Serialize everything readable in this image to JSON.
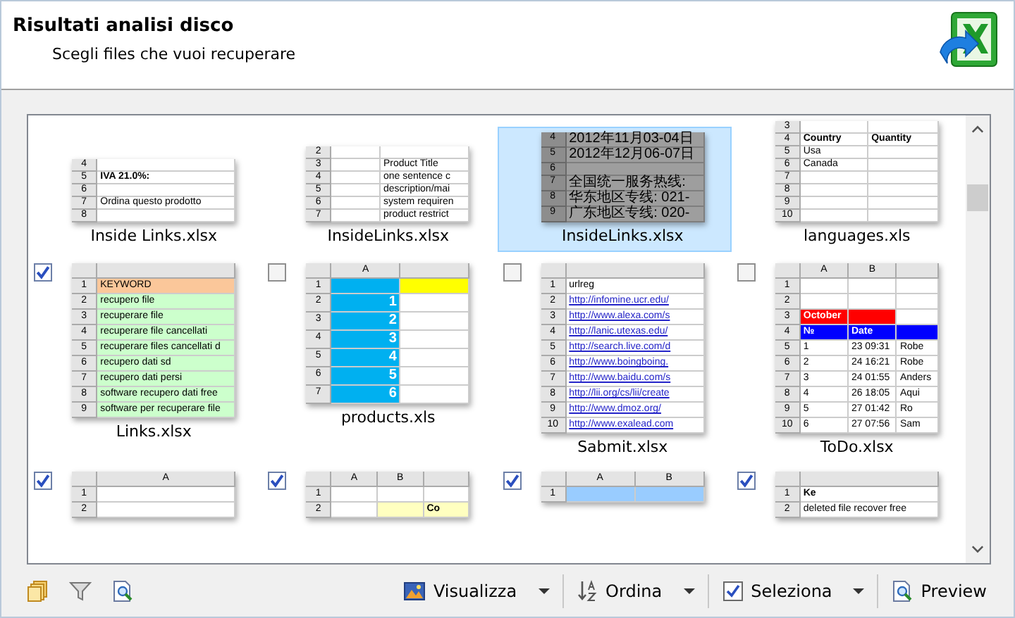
{
  "header": {
    "title": "Risultati analisi disco",
    "subtitle": "Scegli files che vuoi recuperare"
  },
  "grid_rows": [
    {
      "items": [
        {
          "name": "Inside Links.xlsx",
          "selected": false,
          "thumb": {
            "rows": [
              {
                "n": "4",
                "cells": [
                  {}
                ]
              },
              {
                "n": "5",
                "cells": [
                  {
                    "t": "IVA 21.0%:",
                    "kind": "bold"
                  }
                ]
              },
              {
                "n": "6",
                "cells": [
                  {}
                ]
              },
              {
                "n": "7",
                "cells": [
                  {
                    "t": "Ordina questo prodotto"
                  }
                ]
              },
              {
                "n": "8",
                "cells": [
                  {}
                ]
              }
            ]
          }
        },
        {
          "name": "InsideLinks.xlsx",
          "selected": false,
          "thumb": {
            "rows": [
              {
                "n": "2",
                "cells": [
                  {},
                  {}
                ]
              },
              {
                "n": "3",
                "cells": [
                  {},
                  {
                    "t": "Product Title"
                  }
                ]
              },
              {
                "n": "4",
                "cells": [
                  {},
                  {
                    "t": "one sentence c"
                  }
                ]
              },
              {
                "n": "5",
                "cells": [
                  {},
                  {
                    "t": "description/mai"
                  }
                ]
              },
              {
                "n": "6",
                "cells": [
                  {},
                  {
                    "t": "system requiren"
                  }
                ]
              },
              {
                "n": "7",
                "cells": [
                  {},
                  {
                    "t": "product restrict"
                  }
                ]
              }
            ]
          }
        },
        {
          "name": "InsideLinks.xlsx",
          "selected": true,
          "thumb": {
            "rows": [
              {
                "n": "4",
                "cells": [
                  {
                    "t": "2012年11月03-04日"
                  }
                ]
              },
              {
                "n": "5",
                "cells": [
                  {
                    "t": "2012年12月06-07日"
                  }
                ]
              },
              {
                "n": "6",
                "cells": [
                  {}
                ]
              },
              {
                "n": "7",
                "cells": [
                  {
                    "t": "全国统一服务热线:"
                  }
                ]
              },
              {
                "n": "8",
                "cells": [
                  {
                    "t": "华东地区专线: 021-"
                  }
                ]
              },
              {
                "n": "9",
                "cells": [
                  {
                    "t": "广东地区专线: 020-"
                  }
                ]
              }
            ]
          }
        },
        {
          "name": "languages.xls",
          "selected": false,
          "thumb": {
            "rows": [
              {
                "n": "3",
                "cells": [
                  {},
                  {}
                ]
              },
              {
                "n": "4",
                "cells": [
                  {
                    "t": "Country",
                    "kind": "bold"
                  },
                  {
                    "t": "Quantity",
                    "kind": "bold"
                  }
                ]
              },
              {
                "n": "5",
                "cells": [
                  {
                    "t": "Usa"
                  },
                  {}
                ]
              },
              {
                "n": "6",
                "cells": [
                  {
                    "t": "Canada"
                  },
                  {}
                ]
              },
              {
                "n": "7",
                "cells": [
                  {},
                  {}
                ]
              },
              {
                "n": "8",
                "cells": [
                  {},
                  {}
                ]
              },
              {
                "n": "9",
                "cells": [
                  {},
                  {}
                ]
              },
              {
                "n": "10",
                "cells": [
                  {},
                  {}
                ]
              }
            ]
          }
        }
      ]
    },
    {
      "items": [
        {
          "name": "Links.xlsx",
          "selected": false,
          "checked": true,
          "thumb": {
            "header": true,
            "rows": [
              {
                "n": "1",
                "cells": [
                  {
                    "t": "KEYWORD",
                    "color": "#fbc79a"
                  }
                ]
              },
              {
                "n": "2",
                "cells": [
                  {
                    "t": "recupero file",
                    "color": "#ccffcc"
                  }
                ]
              },
              {
                "n": "3",
                "cells": [
                  {
                    "t": "recuperare file",
                    "color": "#ccffcc"
                  }
                ]
              },
              {
                "n": "4",
                "cells": [
                  {
                    "t": "recuperare file cancellati",
                    "color": "#ccffcc"
                  }
                ]
              },
              {
                "n": "5",
                "cells": [
                  {
                    "t": "recuperare files cancellati d",
                    "color": "#ccffcc"
                  }
                ]
              },
              {
                "n": "6",
                "cells": [
                  {
                    "t": "recupero dati sd",
                    "color": "#ccffcc"
                  }
                ]
              },
              {
                "n": "7",
                "cells": [
                  {
                    "t": "recupero dati persi",
                    "color": "#ccffcc"
                  }
                ]
              },
              {
                "n": "8",
                "cells": [
                  {
                    "t": "software recupero dati free",
                    "color": "#ccffcc"
                  }
                ]
              },
              {
                "n": "9",
                "cells": [
                  {
                    "t": "software per recuperare file",
                    "color": "#ccffcc"
                  }
                ]
              }
            ]
          }
        },
        {
          "name": "products.xls",
          "selected": false,
          "checked": false,
          "thumb": {
            "header": true,
            "cols": [
              "A"
            ],
            "rows": [
              {
                "n": "1",
                "cells": [
                  {
                    "color": "#00b0f0"
                  },
                  {
                    "color": "#ffff00"
                  }
                ]
              },
              {
                "n": "2",
                "cells": [
                  {
                    "t": "1",
                    "color": "#00b0f0",
                    "kind": "number"
                  },
                  {}
                ]
              },
              {
                "n": "3",
                "cells": [
                  {
                    "t": "2",
                    "color": "#00b0f0",
                    "kind": "number"
                  },
                  {}
                ]
              },
              {
                "n": "4",
                "cells": [
                  {
                    "t": "3",
                    "color": "#00b0f0",
                    "kind": "number"
                  },
                  {}
                ]
              },
              {
                "n": "5",
                "cells": [
                  {
                    "t": "4",
                    "color": "#00b0f0",
                    "kind": "number"
                  },
                  {}
                ]
              },
              {
                "n": "6",
                "cells": [
                  {
                    "t": "5",
                    "color": "#00b0f0",
                    "kind": "number"
                  },
                  {}
                ]
              },
              {
                "n": "7",
                "cells": [
                  {
                    "t": "6",
                    "color": "#00b0f0",
                    "kind": "number"
                  },
                  {}
                ]
              }
            ]
          }
        },
        {
          "name": "Sabmit.xlsx",
          "selected": false,
          "checked": false,
          "thumb": {
            "header": true,
            "rows": [
              {
                "n": "1",
                "cells": [
                  {
                    "t": "urlreg"
                  }
                ]
              },
              {
                "n": "2",
                "cells": [
                  {
                    "t": "http://infomine.ucr.edu/",
                    "kind": "link"
                  }
                ]
              },
              {
                "n": "3",
                "cells": [
                  {
                    "t": "http://www.alexa.com/s",
                    "kind": "link"
                  }
                ]
              },
              {
                "n": "4",
                "cells": [
                  {
                    "t": "http://lanic.utexas.edu/",
                    "kind": "link"
                  }
                ]
              },
              {
                "n": "5",
                "cells": [
                  {
                    "t": "http://search.live.com/d",
                    "kind": "link"
                  }
                ]
              },
              {
                "n": "6",
                "cells": [
                  {
                    "t": "http://www.boingboing.",
                    "kind": "link"
                  }
                ]
              },
              {
                "n": "7",
                "cells": [
                  {
                    "t": "http://www.baidu.com/s",
                    "kind": "link"
                  }
                ]
              },
              {
                "n": "8",
                "cells": [
                  {
                    "t": "http://lii.org/cs/lii/create",
                    "kind": "link"
                  }
                ]
              },
              {
                "n": "9",
                "cells": [
                  {
                    "t": "http://www.dmoz.org/",
                    "kind": "link"
                  }
                ]
              },
              {
                "n": "10",
                "cells": [
                  {
                    "t": "http://www.exalead.com",
                    "kind": "link"
                  }
                ]
              }
            ]
          }
        },
        {
          "name": "ToDo.xlsx",
          "selected": false,
          "checked": false,
          "thumb": {
            "header": true,
            "cols": [
              "A",
              "B"
            ],
            "rows": [
              {
                "n": "1",
                "cells": [
                  {},
                  {},
                  {}
                ]
              },
              {
                "n": "2",
                "cells": [
                  {},
                  {},
                  {}
                ]
              },
              {
                "n": "3",
                "cells": [
                  {
                    "t": "October",
                    "color": "#ff0000",
                    "kind": "bold"
                  },
                  {
                    "color": "#ff0000"
                  },
                  {}
                ]
              },
              {
                "n": "4",
                "cells": [
                  {
                    "t": "№",
                    "color": "#0000ff",
                    "kind": "bold"
                  },
                  {
                    "t": "Date",
                    "color": "#0000ff",
                    "kind": "bold"
                  },
                  {
                    "color": "#0000ff"
                  }
                ]
              },
              {
                "n": "5",
                "cells": [
                  {
                    "t": "1"
                  },
                  {
                    "t": "23 09:31"
                  },
                  {
                    "t": "Robe"
                  }
                ]
              },
              {
                "n": "6",
                "cells": [
                  {
                    "t": "2"
                  },
                  {
                    "t": "24 16:21"
                  },
                  {
                    "t": "Robe"
                  }
                ]
              },
              {
                "n": "7",
                "cells": [
                  {
                    "t": "3"
                  },
                  {
                    "t": "24 01:55"
                  },
                  {
                    "t": "Anders"
                  }
                ]
              },
              {
                "n": "8",
                "cells": [
                  {
                    "t": "4"
                  },
                  {
                    "t": "26 18:05"
                  },
                  {
                    "t": "Aqui"
                  }
                ]
              },
              {
                "n": "9",
                "cells": [
                  {
                    "t": "5"
                  },
                  {
                    "t": "27 01:42"
                  },
                  {
                    "t": "Ro"
                  }
                ]
              },
              {
                "n": "10",
                "cells": [
                  {
                    "t": "6"
                  },
                  {
                    "t": "27 07:56"
                  },
                  {
                    "t": "Sam"
                  }
                ]
              }
            ]
          }
        }
      ]
    },
    {
      "items": [
        {
          "selected": false,
          "checked": true,
          "thumb": {
            "header": true,
            "cols": [
              "A"
            ],
            "rows": [
              {
                "n": "1",
                "cells": [
                  {}
                ]
              },
              {
                "n": "2",
                "cells": [
                  {}
                ]
              }
            ]
          }
        },
        {
          "selected": false,
          "checked": true,
          "thumb": {
            "header": true,
            "cols": [
              "A",
              "B"
            ],
            "rows": [
              {
                "n": "1",
                "cells": [
                  {},
                  {},
                  {}
                ]
              },
              {
                "n": "2",
                "cells": [
                  {},
                  {
                    "color": "#ffffc0"
                  },
                  {
                    "t": "Co",
                    "color": "#ffffc0",
                    "kind": "bold"
                  }
                ]
              }
            ]
          }
        },
        {
          "selected": false,
          "checked": true,
          "thumb": {
            "header": true,
            "cols": [
              "A",
              "B"
            ],
            "rows": [
              {
                "n": "1",
                "cells": [
                  {
                    "color": "#99ccff"
                  },
                  {
                    "color": "#99ccff"
                  }
                ]
              }
            ]
          }
        },
        {
          "selected": false,
          "checked": true,
          "thumb": {
            "header": true,
            "rows": [
              {
                "n": "1",
                "cells": [
                  {
                    "t": "Ke",
                    "kind": "bold"
                  }
                ]
              },
              {
                "n": "2",
                "cells": [
                  {
                    "t": "deleted file recover free"
                  }
                ]
              }
            ]
          }
        }
      ]
    }
  ],
  "toolbar": {
    "buttons": [
      {
        "label": "Visualizza",
        "kind": "view",
        "dropdown": true
      },
      {
        "label": "Ordina",
        "kind": "sort",
        "dropdown": true
      },
      {
        "label": "Seleziona",
        "kind": "select",
        "dropdown": true
      },
      {
        "label": "Preview",
        "kind": "preview",
        "dropdown": false
      }
    ]
  }
}
